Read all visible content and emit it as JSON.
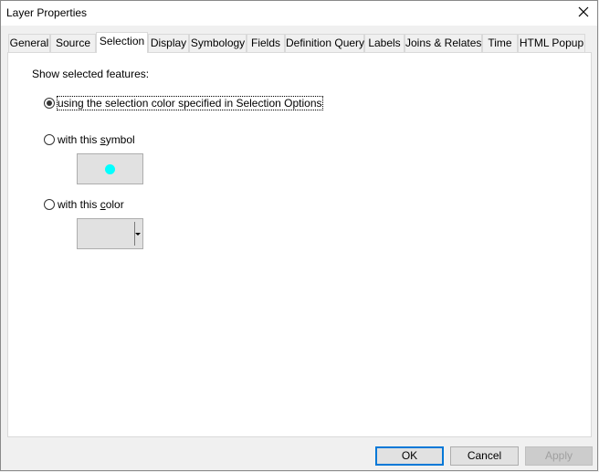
{
  "window": {
    "title": "Layer Properties",
    "close_icon": "close-icon"
  },
  "tabs": [
    {
      "label": "General"
    },
    {
      "label": "Source"
    },
    {
      "label": "Selection",
      "active": true
    },
    {
      "label": "Display"
    },
    {
      "label": "Symbology"
    },
    {
      "label": "Fields"
    },
    {
      "label": "Definition Query"
    },
    {
      "label": "Labels"
    },
    {
      "label": "Joins & Relates"
    },
    {
      "label": "Time"
    },
    {
      "label": "HTML Popup"
    }
  ],
  "selection": {
    "heading": "Show selected features:",
    "option_selection_color": {
      "label": "using the selection color specified in Selection Options",
      "checked": true
    },
    "option_symbol": {
      "label_pre": "with this ",
      "label_accel": "s",
      "label_post": "ymbol",
      "checked": false
    },
    "symbol_color": "#00ffff",
    "option_color": {
      "label_pre": "with this ",
      "label_accel": "c",
      "label_post": "olor",
      "checked": false
    }
  },
  "buttons": {
    "ok": "OK",
    "cancel": "Cancel",
    "apply": "Apply"
  }
}
